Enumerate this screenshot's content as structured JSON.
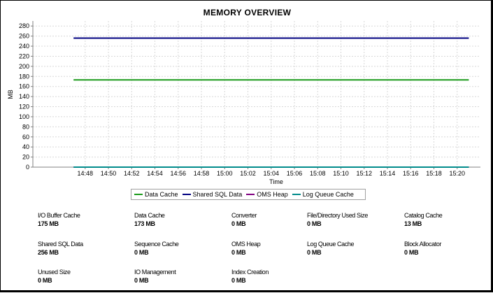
{
  "chart_data": {
    "type": "line",
    "title": "MEMORY OVERVIEW",
    "xlabel": "Time",
    "ylabel": "MB",
    "ylim": [
      0,
      290
    ],
    "yticks": [
      0,
      20,
      40,
      60,
      80,
      100,
      120,
      140,
      160,
      180,
      200,
      220,
      240,
      260,
      280
    ],
    "categories": [
      "14:48",
      "14:50",
      "14:52",
      "14:54",
      "14:56",
      "14:58",
      "15:00",
      "15:02",
      "15:04",
      "15:06",
      "15:08",
      "15:10",
      "15:12",
      "15:14",
      "15:16",
      "15:18",
      "15:20"
    ],
    "grid": true,
    "legend_position": "bottom",
    "series": [
      {
        "name": "Data Cache",
        "color": "#1a9a1a",
        "x": [
          "14:47",
          "15:21"
        ],
        "values": [
          173,
          173
        ]
      },
      {
        "name": "Shared SQL Data",
        "color": "#000080",
        "x": [
          "14:47",
          "15:21"
        ],
        "values": [
          256,
          256
        ]
      },
      {
        "name": "OMS Heap",
        "color": "#800080",
        "x": [
          "14:47",
          "15:21"
        ],
        "values": [
          0,
          0
        ]
      },
      {
        "name": "Log Queue Cache",
        "color": "#008b8b",
        "x": [
          "14:47",
          "15:21"
        ],
        "values": [
          0,
          0
        ]
      }
    ]
  },
  "stats": [
    {
      "label": "I/O Buffer Cache",
      "value": "175 MB"
    },
    {
      "label": "Data Cache",
      "value": "173 MB"
    },
    {
      "label": "Converter",
      "value": "0 MB"
    },
    {
      "label": "File/Directory Used Size",
      "value": "0 MB"
    },
    {
      "label": "Catalog Cache",
      "value": "13 MB"
    },
    {
      "label": "Shared SQL Data",
      "value": "256 MB"
    },
    {
      "label": "Sequence Cache",
      "value": "0 MB"
    },
    {
      "label": "OMS Heap",
      "value": "0 MB"
    },
    {
      "label": "Log Queue Cache",
      "value": "0 MB"
    },
    {
      "label": "Block Allocator",
      "value": "0 MB"
    },
    {
      "label": "Unused Size",
      "value": "0 MB"
    },
    {
      "label": "IO Management",
      "value": "0 MB"
    },
    {
      "label": "Index Creation",
      "value": "0 MB"
    }
  ]
}
